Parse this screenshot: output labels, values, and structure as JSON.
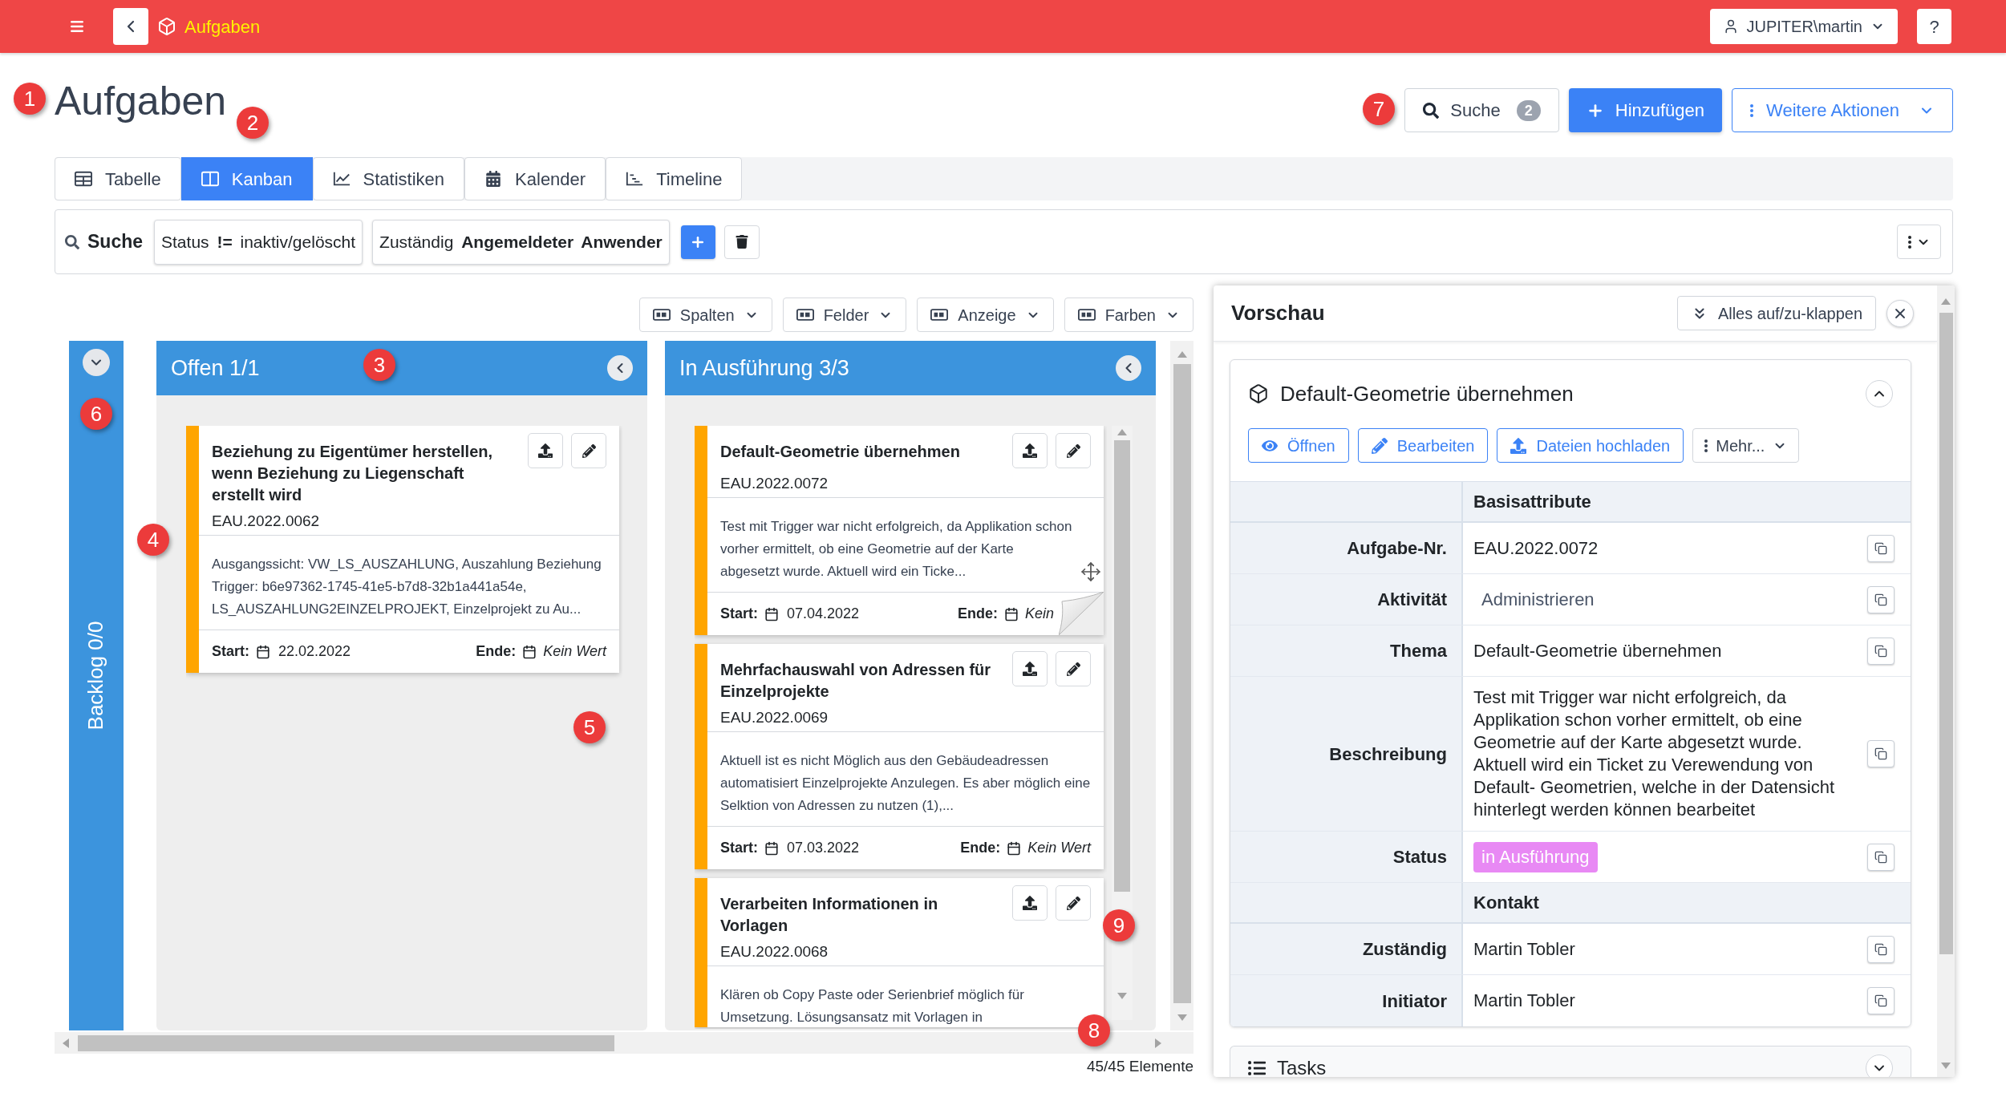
{
  "top_bar": {
    "title": "Aufgaben",
    "user": "JUPITER\\martin",
    "help": "?"
  },
  "header": {
    "title": "Aufgaben",
    "search": {
      "label": "Suche",
      "count": "2"
    },
    "add_button": "Hinzufügen",
    "more_button": "Weitere Aktionen"
  },
  "view_tabs": [
    {
      "label": "Tabelle",
      "selected": false
    },
    {
      "label": "Kanban",
      "selected": true
    },
    {
      "label": "Statistiken",
      "selected": false
    },
    {
      "label": "Kalender",
      "selected": false
    },
    {
      "label": "Timeline",
      "selected": false
    }
  ],
  "filter_bar": {
    "label": "Suche",
    "filters": [
      "Status **!=** inaktiv/gelöscht",
      "Zuständig **Angemeldeter Anwender**"
    ]
  },
  "board_toolbar": [
    "Spalten",
    "Felder",
    "Anzeige",
    "Farben"
  ],
  "board": {
    "columns": [
      {
        "title": "Backlog 0/0",
        "collapsed": true
      },
      {
        "title": "Offen 1/1",
        "collapsed": false,
        "cards": [
          {
            "title": "Beziehung zu Eigentümer herstellen, wenn Beziehung zu Liegenschaft erstellt wird",
            "number": "EAU.2022.0062",
            "description": "Ausgangssicht: VW_LS_AUSZAHLUNG, Auszahlung Beziehung Trigger: b6e97362-1745-41e5-b7d8-32b1a441a54e, LS_AUSZAHLUNG2EINZELPROJEKT, Einzelprojekt zu Au...",
            "start_label": "Start:",
            "start": "22.02.2022",
            "end_label": "Ende:",
            "end": "Kein Wert",
            "hovered": false
          }
        ]
      },
      {
        "title": "In Ausführung 3/3",
        "collapsed": false,
        "cards": [
          {
            "title": "Default-Geometrie übernehmen",
            "number": "EAU.2022.0072",
            "description": "Test mit Trigger war nicht erfolgreich, da Applikation schon vorher ermittelt, ob eine Geometrie auf der Karte abgesetzt wurde. Aktuell wird ein Ticke...",
            "start_label": "Start:",
            "start": "07.04.2022",
            "end_label": "Ende:",
            "end": "Kein",
            "hovered": true
          },
          {
            "title": "Mehrfachauswahl von Adressen für Einzelprojekte",
            "number": "EAU.2022.0069",
            "description": "Aktuell ist es nicht Möglich aus den Gebäudeadressen automatisiert Einzelprojekte Anzulegen. Es aber möglich eine Selktion von Adressen zu nutzen (1),...",
            "start_label": "Start:",
            "start": "07.03.2022",
            "end_label": "Ende:",
            "end": "Kein Wert",
            "hovered": false
          },
          {
            "title": "Verarbeiten Informationen in Vorlagen",
            "number": "EAU.2022.0068",
            "description": "Klären ob Copy Paste oder Serienbrief möglich für Umsetzung. Lösungsansatz mit Vorlagen in",
            "hovered": false
          }
        ]
      }
    ]
  },
  "item_count": "45/45 Elemente",
  "preview": {
    "title": "Vorschau",
    "toggle_all": "Alles auf/zu-klappen",
    "record": {
      "title": "Default-Geometrie übernehmen",
      "expanded": true,
      "actions": [
        {
          "label": "Öffnen",
          "kind": "action"
        },
        {
          "label": "Bearbeiten",
          "kind": "action"
        },
        {
          "label": "Dateien hochladen",
          "kind": "action"
        },
        {
          "label": "Mehr...",
          "kind": "menu"
        }
      ],
      "sections": [
        {
          "title": "Basisattribute",
          "rows": [
            {
              "label": "Aufgabe-Nr.",
              "value": "EAU.2022.0072",
              "kind": "text"
            },
            {
              "label": "Aktivität",
              "value": "Administrieren",
              "kind": "reference"
            },
            {
              "label": "Thema",
              "value": "Default-Geometrie übernehmen",
              "kind": "text"
            },
            {
              "label": "Beschreibung",
              "value": "Test mit Trigger war nicht erfolgreich, da Applikation schon vorher ermittelt, ob eine Geometrie auf der Karte abgesetzt wurde. Aktuell wird ein Ticket zu Verewendung von Default- Geometrien, welche in der Datensicht hinterlegt werden können bearbeitet",
              "kind": "text"
            },
            {
              "label": "Status",
              "value": "in Ausführung",
              "kind": "badge",
              "color": "#e889f4"
            }
          ]
        },
        {
          "title": "Kontakt",
          "rows": [
            {
              "label": "Zuständig",
              "value": "Martin Tobler",
              "kind": "text"
            },
            {
              "label": "Initiator",
              "value": "Martin Tobler",
              "kind": "text"
            }
          ]
        }
      ]
    },
    "tasks": {
      "title": "Tasks",
      "expanded": false
    }
  },
  "callouts": [
    "1",
    "2",
    "3",
    "4",
    "5",
    "6",
    "7",
    "8",
    "9"
  ]
}
